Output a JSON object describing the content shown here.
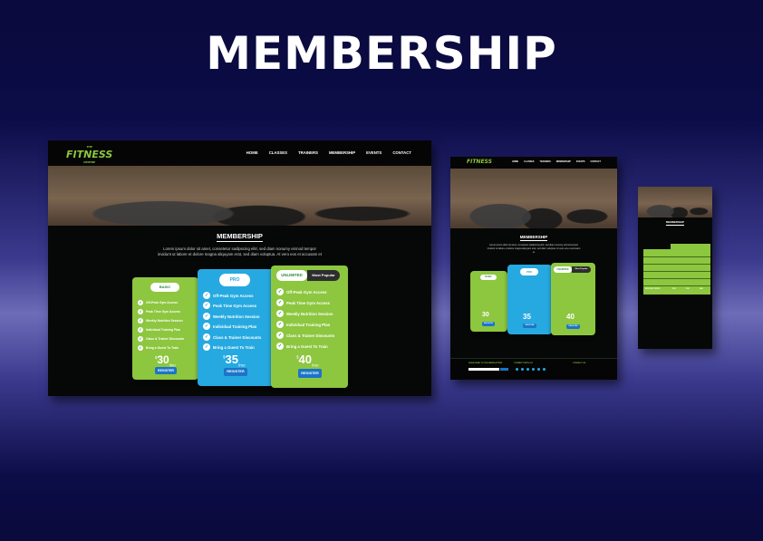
{
  "page": {
    "title": "MEMBERSHIP"
  },
  "brand": {
    "logo": "FITNESS",
    "logo_top": "THE",
    "logo_bottom": "CENTRE"
  },
  "nav": {
    "items": [
      "HOME",
      "CLASSES",
      "TRAINERS",
      "MEMBERSHIP",
      "EVENTS",
      "CONTACT"
    ]
  },
  "section": {
    "title": "MEMBERSHIP",
    "lorem_1": "Lorem ipsum dolor sit amet, consetetur sadipscing elitr, sed diam nonumy eirmod tempor",
    "lorem_2": "invidunt ut labore et dolore magna aliquyam erat, sed diam voluptua. At vero eos et accusam et"
  },
  "plans": [
    {
      "name": "BASIC",
      "price": "30",
      "currency": "$",
      "period": "/mo",
      "features": [
        "Off-Peak Gym Access",
        "Peak Time Gym Access",
        "Weekly Nutrition Session",
        "Individual Training Plan",
        "Class & Trainer Discounts",
        "Bring a Guest To Train"
      ],
      "button": "REGISTER",
      "color": "#8dc63f"
    },
    {
      "name": "PRO",
      "price": "35",
      "currency": "$",
      "period": "/mo",
      "features": [
        "Off-Peak Gym Access",
        "Peak Time Gym Access",
        "Weekly Nutrition Session",
        "Individual Training Plan",
        "Class & Trainer Discounts",
        "Bring a Guest To Train"
      ],
      "button": "REGISTER",
      "color": "#26a9e0"
    },
    {
      "name": "UNLIMITED",
      "badge": "Most Popular",
      "price": "40",
      "currency": "$",
      "period": "/mo",
      "features": [
        "Off-Peak Gym Access",
        "Peak Time Gym Access",
        "Weekly Nutrition Session",
        "Individual Training Plan",
        "Class & Trainer Discounts",
        "Bring a Guest To Train"
      ],
      "button": "REGISTER",
      "color": "#8dc63f"
    }
  ],
  "footer": {
    "col1": "SUBSCRIBE TO THE NEWSLETTER",
    "col2": "CONNECT WITH US",
    "col3": "CONTACT US"
  },
  "mobile_table": {
    "headers": [
      "",
      "BASIC",
      "PRO",
      "UNL"
    ],
    "last_row": "MONTHLY PRICE",
    "prices": [
      "$30",
      "$35",
      "$40"
    ]
  },
  "colors": {
    "accent_green": "#8dc63f",
    "accent_blue": "#26a9e0",
    "page_bg": "#0a0a3c",
    "device_bg": "#060807"
  }
}
